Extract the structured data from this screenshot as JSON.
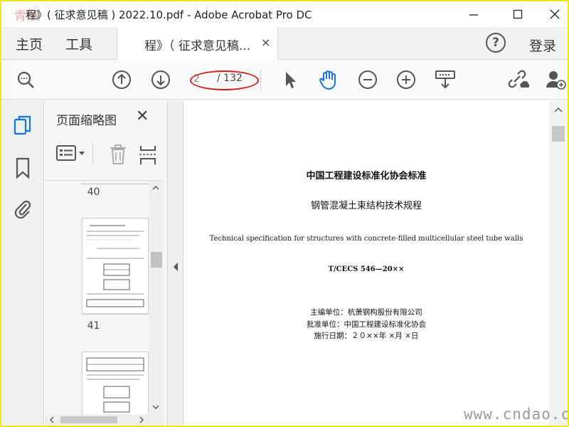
{
  "window": {
    "title": "程》( 征求意见稿 ) 2022.10.pdf - Adobe Acrobat Pro DC",
    "watermark_logo": "青椒网"
  },
  "tabs": {
    "home": "主页",
    "tools": "工具",
    "document_tab": "程》（ 征求意见稿...",
    "close_glyph": "×",
    "help_glyph": "?",
    "login": "登录"
  },
  "toolbar": {
    "current_page": "2",
    "page_total": "/ 132"
  },
  "thumbnails_panel": {
    "title": "页面缩略图",
    "close_glyph": "✕",
    "page_labels": [
      "40",
      "41"
    ]
  },
  "document": {
    "heading_cn": "中国工程建设标准化协会标准",
    "title_cn": "钢管混凝土束结构技术规程",
    "title_en": "Technical specification for structures with concrete-filled multicellular steel tube walls",
    "code": "T/CECS 546—20××",
    "editor_unit": "主编单位：杭萧钢构股份有限公司",
    "approval_unit": "批准单位：中国工程建设标准化协会",
    "effective_date": "施行日期：２０××年 ×月 ×日"
  },
  "site_watermark": "www.cndao.com",
  "colors": {
    "accent_blue": "#1473e6",
    "annotation_red": "#d41e1e",
    "border_yellow": "#f0e61a"
  }
}
